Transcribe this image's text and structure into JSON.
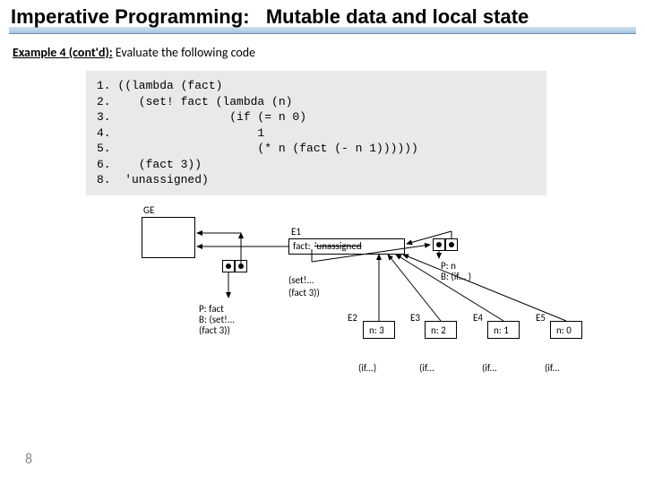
{
  "title_left": "Imperative Programming:",
  "title_right": "Mutable data and local state",
  "subtitle_bold": "Example 4 (cont'd):",
  "subtitle_rest": " Evaluate the following code",
  "code": "1. ((lambda (fact)\n2.    (set! fact (lambda (n)\n3.                 (if (= n 0)\n4.                     1\n5.                     (* n (fact (- n 1))))))\n6.    (fact 3))\n8.  'unassigned)",
  "diagram": {
    "GE": "GE",
    "E1": "E1",
    "fact_label": "fact:",
    "unassigned": "'unassigned",
    "set_body": "(set!...",
    "fact3": "(fact 3))",
    "P_fact": "P: fact",
    "B_set": "B: (set!...",
    "B_set2": "      (fact 3))",
    "P_n": "P: n",
    "B_if": "B: (if... )",
    "E2": "E2",
    "n3": "n: 3",
    "E3": "E3",
    "n2": "n: 2",
    "E4": "E4",
    "n1": "n: 1",
    "E5": "E5",
    "n0": "n: 0",
    "if": "(if...)",
    "if2": "(if..."
  },
  "page": "8"
}
